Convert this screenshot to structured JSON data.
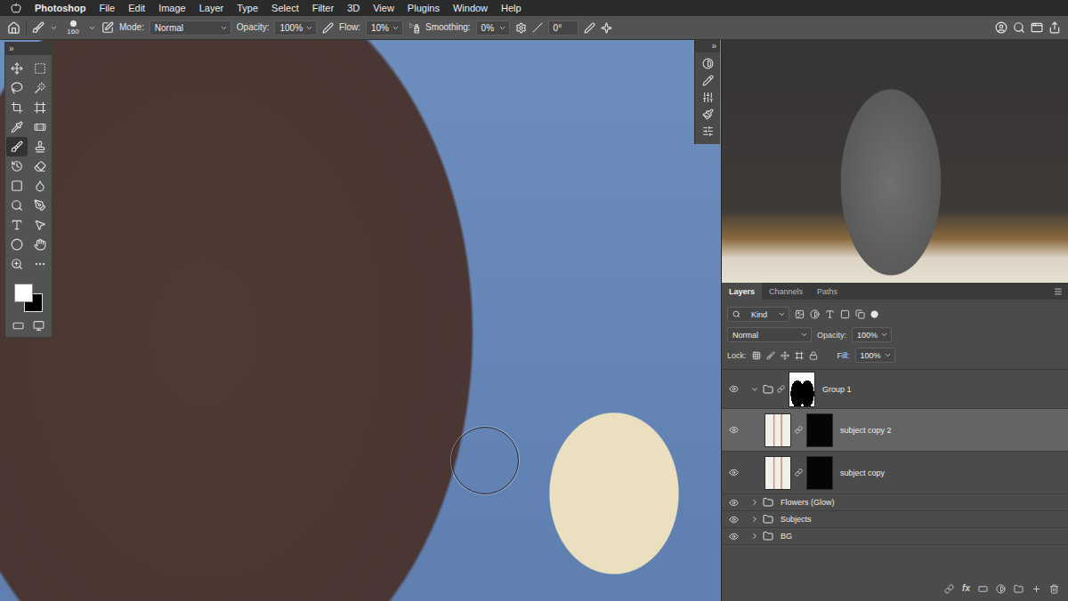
{
  "menu_bar": {
    "app": "Photoshop",
    "items": [
      "File",
      "Edit",
      "Image",
      "Layer",
      "Type",
      "Select",
      "Filter",
      "3D",
      "View",
      "Plugins",
      "Window",
      "Help"
    ]
  },
  "options_bar": {
    "brush_size": "160",
    "mode_label": "Mode:",
    "mode": "Normal",
    "opacity_label": "Opacity:",
    "opacity": "100%",
    "flow_label": "Flow:",
    "flow": "10%",
    "smoothing_label": "Smoothing:",
    "smoothing": "0%",
    "angle": "0°"
  },
  "toolbox": {
    "collapse_glyph": "»",
    "tools": [
      {
        "selected": false
      },
      {
        "selected": false
      },
      {
        "selected": false
      },
      {
        "selected": false
      },
      {
        "selected": false
      },
      {
        "selected": false
      },
      {
        "selected": false
      },
      {
        "selected": false
      },
      {
        "selected": true
      },
      {
        "selected": false
      },
      {
        "selected": false
      },
      {
        "selected": false
      },
      {
        "selected": false
      },
      {
        "selected": false
      },
      {
        "selected": false
      },
      {
        "selected": false
      },
      {
        "selected": false
      },
      {
        "selected": false
      },
      {
        "selected": false
      },
      {
        "selected": false
      },
      {
        "selected": false
      },
      {
        "selected": false
      }
    ],
    "swatches": [
      {
        "color": "#ffffff"
      },
      {
        "color": "#000000"
      }
    ]
  },
  "dock": {
    "collapse_glyph": "»"
  },
  "layers_panel": {
    "tabs": [
      {
        "label": "Layers",
        "selected": true
      },
      {
        "label": "Channels",
        "selected": false
      },
      {
        "label": "Paths",
        "selected": false
      }
    ],
    "filter": "Kind",
    "blend_mode": "Normal",
    "opacity_label": "Opacity:",
    "opacity": "100%",
    "lock_label": "Lock:",
    "fill_label": "Fill:",
    "fill": "100%",
    "layers": [
      {
        "name": "Group 1",
        "kind": "group",
        "expanded": true,
        "has_mask": true,
        "selected": false,
        "visible": true,
        "children": [
          {
            "name": "subject copy 2",
            "kind": "layer",
            "has_mask": true,
            "selected": true,
            "visible": true
          },
          {
            "name": "subject copy",
            "kind": "layer",
            "has_mask": true,
            "selected": false,
            "visible": true
          }
        ]
      },
      {
        "name": "Flowers (Glow)",
        "kind": "group",
        "expanded": false,
        "has_mask": false,
        "selected": false,
        "visible": true,
        "children": []
      },
      {
        "name": "Subjects",
        "kind": "group",
        "expanded": false,
        "has_mask": false,
        "selected": false,
        "visible": true,
        "children": []
      },
      {
        "name": "BG",
        "kind": "group",
        "expanded": false,
        "has_mask": false,
        "selected": false,
        "visible": true,
        "children": []
      }
    ],
    "fx_label": "fx"
  }
}
